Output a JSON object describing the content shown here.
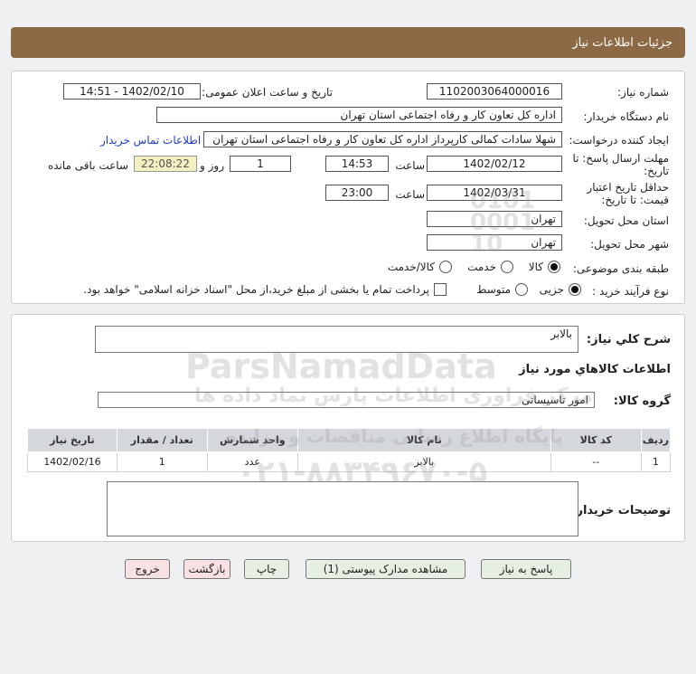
{
  "header": {
    "title": "جزئیات اطلاعات نیاز"
  },
  "form": {
    "need_number_label": "شماره نیاز:",
    "need_number": "1102003064000016",
    "announce_label": "تاریخ و ساعت اعلان عمومی:",
    "announce_value": "1402/02/10 - 14:51",
    "buyer_org_label": "نام دستگاه خریدار:",
    "buyer_org": "اداره کل تعاون  کار و رفاه اجتماعی استان تهران",
    "creator_label": "ایجاد کننده درخواست:",
    "creator": "شهلا سادات کمالی کارپرداز اداره کل تعاون  کار و رفاه اجتماعی استان تهران",
    "contact_link": "اطلاعات تماس خریدار",
    "deadline_label_1": "مهلت ارسال پاسخ: تا",
    "deadline_label_2": "تاریخ:",
    "deadline_date": "1402/02/12",
    "hour_label": "ساعت",
    "deadline_time": "14:53",
    "days_value": "1",
    "days_and_label": "روز و",
    "remaining_time": "22:08:22",
    "remaining_label": "ساعت باقی مانده",
    "validity_label_1": "حداقل تاریخ اعتبار",
    "validity_label_2": "قیمت: تا تاریخ:",
    "validity_date": "1402/03/31",
    "validity_hour_label": "ساعت",
    "validity_time": "23:00",
    "province_label": "استان محل تحویل:",
    "province": "تهران",
    "city_label": "شهر محل تحویل:",
    "city": "تهران",
    "category_label": "طبقه بندی موضوعی:",
    "category_options": [
      "کالا",
      "خدمت",
      "کالا/خدمت"
    ],
    "process_label": "نوع فرآیند خرید :",
    "process_options": [
      "جزیی",
      "متوسط"
    ],
    "payment_note": "پرداخت تمام یا بخشی از مبلغ خرید،از محل \"اسناد خزانه اسلامی\" خواهد بود."
  },
  "details": {
    "summary_label": "شرح کلي نياز:",
    "summary": "بالابر",
    "goods_info_title": "اطلاعات کالاهاي مورد نياز",
    "goods_group_label": "گروه کالا:",
    "goods_group": "امور تاسیساتی",
    "table": {
      "headers": [
        "ردیف",
        "کد کالا",
        "نام کالا",
        "واحد شمارش",
        "تعداد / مقدار",
        "تاریخ نیاز"
      ],
      "rows": [
        [
          "1",
          "--",
          "بالابر",
          "عدد",
          "1",
          "1402/02/16"
        ]
      ]
    },
    "buyer_notes_label": "توضیحات خریدار:"
  },
  "buttons": {
    "reply": "پاسخ به نیاز",
    "attachments": "مشاهده مدارک پیوستی (1)",
    "print": "چاپ",
    "back": "بازگشت",
    "exit": "خروج"
  },
  "watermark": {
    "brand": "ParsNamadData",
    "tagline": "مرکز فراوری اطلاعات پارس نماد داده ها",
    "portal": "پایگاه اطلاع رسانی مناقصات و مزایده",
    "phone": "۰۲۱-۸۸۳۴۹۶۷۰-۵",
    "code": "0101 0001 10"
  }
}
